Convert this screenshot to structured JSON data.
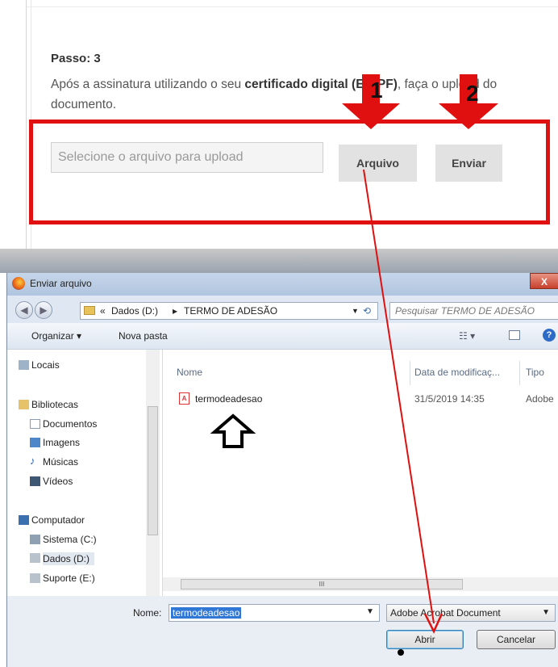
{
  "web": {
    "step_title": "Passo: 3",
    "step_text_before": "Após a assinatura utilizando o seu ",
    "step_text_bold": "certificado digital (E-CPF)",
    "step_text_after": ", faça o upload do documento.",
    "upload_placeholder": "Selecione o arquivo para upload",
    "arquivo_label": "Arquivo",
    "enviar_label": "Enviar",
    "marker1": "1",
    "marker2": "2"
  },
  "dialog": {
    "title": "Enviar arquivo",
    "close": "X",
    "address": {
      "chevrons": "«",
      "drive": "Dados (D:)",
      "sep": "▸",
      "folder": "TERMO DE ADESÃO"
    },
    "search_placeholder": "Pesquisar TERMO DE ADESÃO",
    "toolbar": {
      "organize": "Organizar ▾",
      "new_folder": "Nova pasta",
      "view": "☷ ▾",
      "help": "?"
    },
    "nav": {
      "locais": "Locais",
      "bibliotecas": "Bibliotecas",
      "documentos": "Documentos",
      "imagens": "Imagens",
      "musicas": "Músicas",
      "videos": "Vídeos",
      "computador": "Computador",
      "sistema": "Sistema (C:)",
      "dados": "Dados (D:)",
      "suporte": "Suporte (E:)"
    },
    "columns": {
      "name": "Nome",
      "date": "Data de modificaç...",
      "type": "Tipo"
    },
    "file": {
      "name": "termodeadesao",
      "date": "31/5/2019 14:35",
      "type": "Adobe"
    },
    "scroll_grip": "III",
    "name_label": "Nome:",
    "name_value": "termodeadesao",
    "file_type": "Adobe Acrobat Document",
    "open_label": "Abrir",
    "cancel_label": "Cancelar"
  },
  "colors": {
    "highlight_red": "#e01010",
    "selection_blue": "#3178d6"
  }
}
